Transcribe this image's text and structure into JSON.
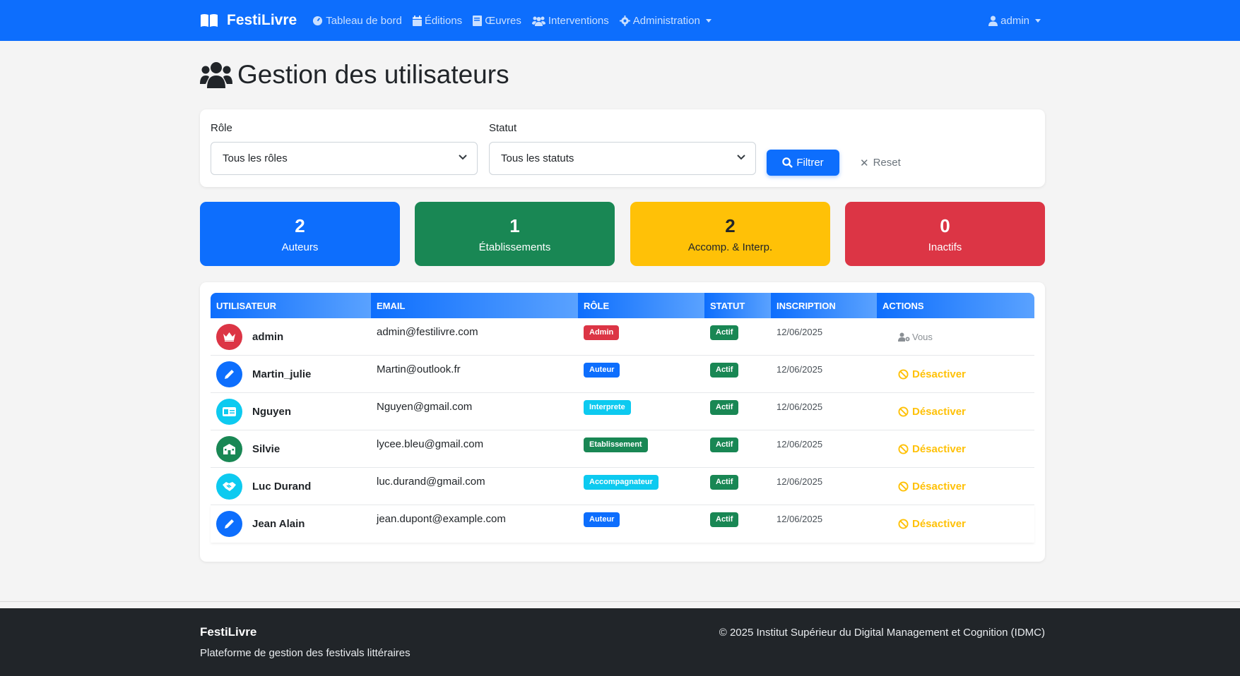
{
  "navbar": {
    "brand": "FestiLivre",
    "links": [
      {
        "label": "Tableau de bord",
        "icon": "dashboard-icon"
      },
      {
        "label": "Éditions",
        "icon": "calendar-icon"
      },
      {
        "label": "Œuvres",
        "icon": "book-icon"
      },
      {
        "label": "Interventions",
        "icon": "users-icon"
      },
      {
        "label": "Administration",
        "icon": "gear-icon"
      }
    ],
    "user": "admin"
  },
  "page": {
    "title": "Gestion des utilisateurs"
  },
  "filters": {
    "role_label": "Rôle",
    "role_value": "Tous les rôles",
    "status_label": "Statut",
    "status_value": "Tous les statuts",
    "filter_button": "Filtrer",
    "reset_button": "Reset"
  },
  "stats": [
    {
      "value": "2",
      "label": "Auteurs",
      "color": "#0d6efd"
    },
    {
      "value": "1",
      "label": "Établissements",
      "color": "#198754"
    },
    {
      "value": "2",
      "label": "Accomp. & Interp.",
      "color": "#ffc107"
    },
    {
      "value": "0",
      "label": "Inactifs",
      "color": "#dc3545"
    }
  ],
  "table": {
    "headers": [
      "UTILISATEUR",
      "EMAIL",
      "RÔLE",
      "STATUT",
      "INSCRIPTION",
      "ACTIONS"
    ],
    "rows": [
      {
        "user": "admin",
        "email": "admin@festilivre.com",
        "role": "Admin",
        "status": "Actif",
        "date": "12/06/2025",
        "action": "Vous"
      },
      {
        "user": "Martin_julie",
        "email": "Martin@outlook.fr",
        "role": "Auteur",
        "status": "Actif",
        "date": "12/06/2025",
        "action": "Désactiver"
      },
      {
        "user": "Nguyen",
        "email": "Nguyen@gmail.com",
        "role": "Interprete",
        "status": "Actif",
        "date": "12/06/2025",
        "action": "Désactiver"
      },
      {
        "user": "Silvie",
        "email": "lycee.bleu@gmail.com",
        "role": "Etablissement",
        "status": "Actif",
        "date": "12/06/2025",
        "action": "Désactiver"
      },
      {
        "user": "Luc Durand",
        "email": "luc.durand@gmail.com",
        "role": "Accompagnateur",
        "status": "Actif",
        "date": "12/06/2025",
        "action": "Désactiver"
      },
      {
        "user": "Jean Alain",
        "email": "jean.dupont@example.com",
        "role": "Auteur",
        "status": "Actif",
        "date": "12/06/2025",
        "action": "Désactiver"
      }
    ]
  },
  "colors": {
    "primary": "#0d6efd",
    "success": "#198754",
    "warning": "#ffc107",
    "danger": "#dc3545",
    "info": "#0dcaf0"
  },
  "footer": {
    "brand": "FestiLivre",
    "tagline": "Plateforme de gestion des festivals littéraires",
    "copyright": "© 2025 Institut Supérieur du Digital Management et Cognition (IDMC)"
  }
}
